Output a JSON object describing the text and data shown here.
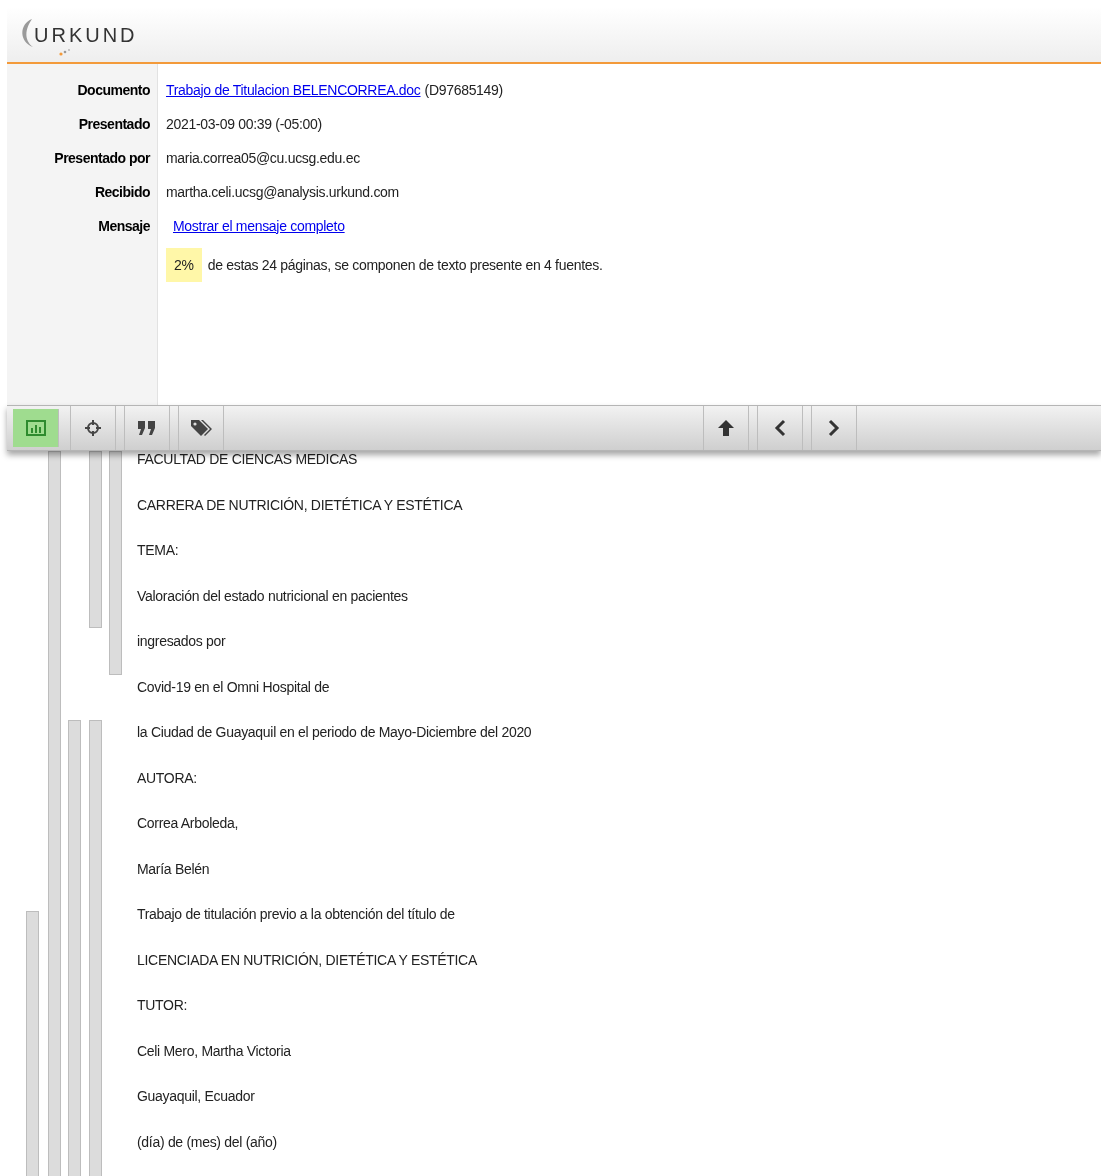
{
  "header": {
    "logo": "URKUND"
  },
  "details": [
    {
      "label": "Documento",
      "kind": "link",
      "value": "Trabajo de Titulacion BELENCORREA.doc",
      "suffix": "(D97685149)"
    },
    {
      "label": "Presentado",
      "kind": "text",
      "value": "2021-03-09 00:39 (-05:00)"
    },
    {
      "label": "Presentado por",
      "kind": "text",
      "value": "maria.correa05@cu.ucsg.edu.ec"
    },
    {
      "label": "Recibido",
      "kind": "text",
      "value": "martha.celi.ucsg@analysis.urkund.com"
    },
    {
      "label": "Mensaje",
      "kind": "link",
      "value": "Mostrar el mensaje completo"
    }
  ],
  "summary": {
    "percent": "2%",
    "text": "de estas 24 páginas, se componen de texto presente en 4 fuentes."
  },
  "toolbar": {
    "tools": [
      {
        "kind": "chart",
        "selected": true
      },
      {
        "kind": "crosshair",
        "selected": false
      },
      {
        "kind": "quote",
        "selected": false
      },
      {
        "kind": "tags",
        "selected": false
      }
    ],
    "nav": [
      {
        "kind": "up"
      },
      {
        "kind": "prev"
      },
      {
        "kind": "next"
      }
    ]
  },
  "document": {
    "lines": [
      "FACULTAD DE CIENCAS MEDICAS",
      "CARRERA DE NUTRICIÓN, DIETÉTICA Y ESTÉTICA",
      "TEMA:",
      "Valoración del estado nutricional en pacientes",
      "ingresados por",
      "Covid-19 en el Omni Hospital de",
      "la Ciudad de Guayaquil en el periodo de Mayo-Diciembre del 2020",
      "AUTORA:",
      "Correa Arboleda,",
      "María Belén",
      "Trabajo de titulación previo a la obtención del título de",
      "LICENCIADA EN NUTRICIÓN, DIETÉTICA Y ESTÉTICA",
      "TUTOR:",
      "Celi Mero, Martha Victoria",
      "Guayaquil, Ecuador",
      "(día) de (mes) del (año)"
    ]
  }
}
